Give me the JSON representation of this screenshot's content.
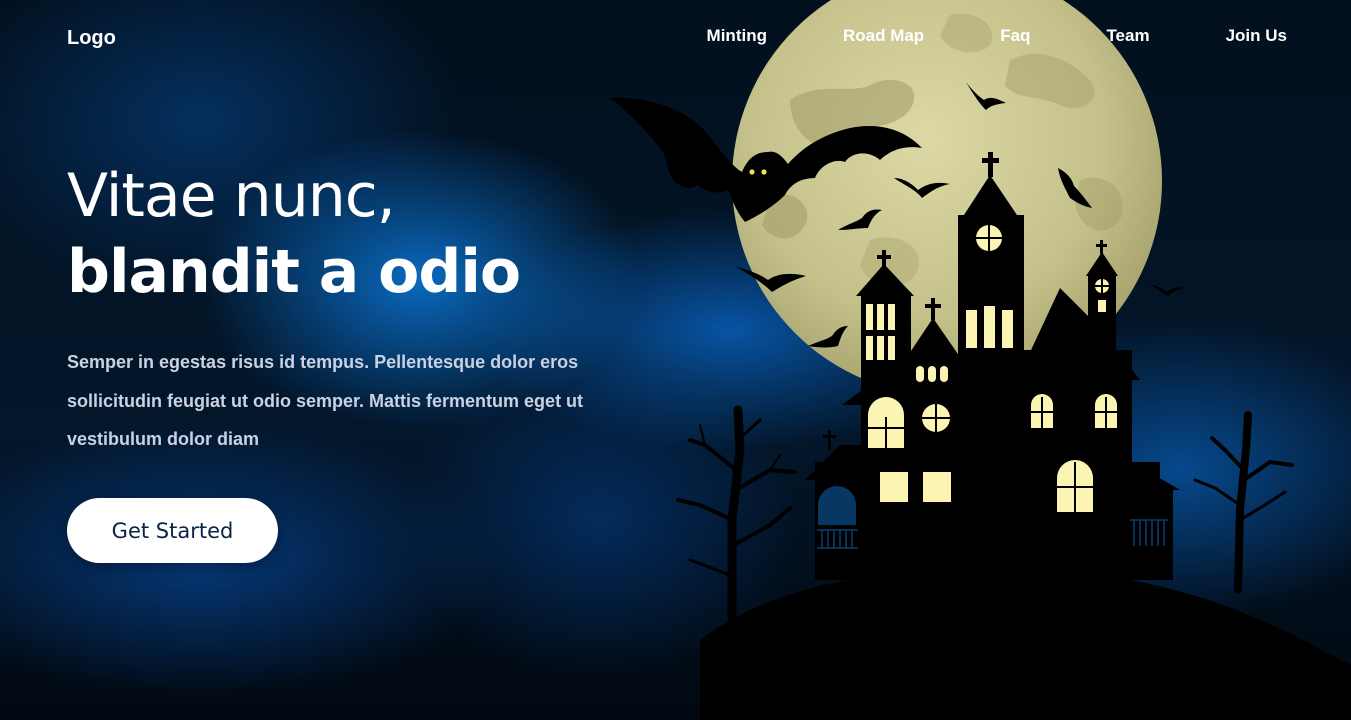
{
  "nav": {
    "logo": "Logo",
    "items": [
      "Minting",
      "Road Map",
      "Faq",
      "Team",
      "Join Us"
    ]
  },
  "hero": {
    "headline_line1": "Vitae nunc,",
    "headline_line2": "blandit a odio",
    "description": "Semper in egestas risus id tempus. Pellentesque dolor eros sollicitudin feugiat ut odio semper. Mattis fermentum eget ut vestibulum dolor diam",
    "cta_label": "Get Started"
  },
  "illustration": {
    "icons": [
      "moon-icon",
      "bat-icon",
      "haunted-house-icon",
      "bare-tree-icon"
    ],
    "colors": {
      "moon": "#c9c58a",
      "window_light": "#fbf4b2",
      "silhouette": "#000000",
      "fog_blue": "#0a6ec8"
    }
  }
}
